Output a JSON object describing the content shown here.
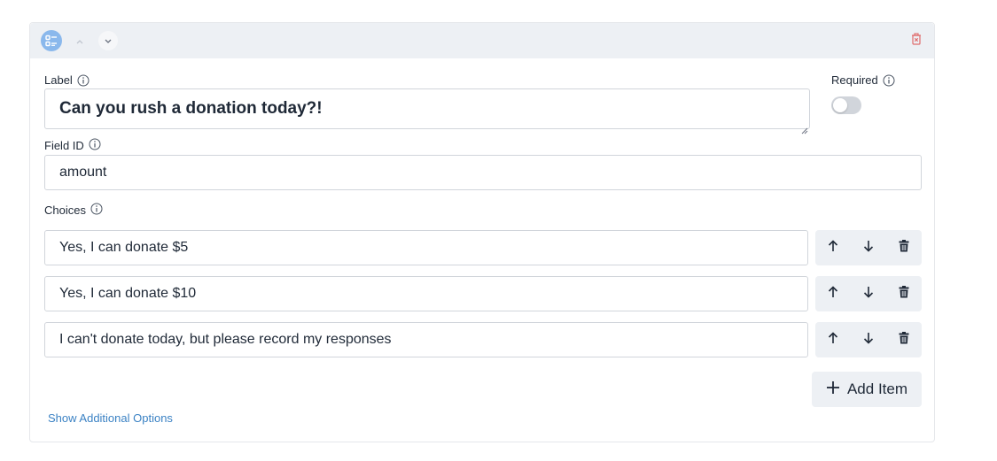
{
  "colors": {
    "accent": "#3b82c4",
    "header_bg": "#edf0f4",
    "type_icon_bg": "#8ab8ec",
    "delete_red": "#e06b6b"
  },
  "header": {
    "type_icon": "list-icon",
    "move_up_icon": "chevron-up-icon",
    "move_down_icon": "chevron-down-icon",
    "delete_icon": "trash-icon"
  },
  "label_field": {
    "label": "Label",
    "value": "Can you rush a donation today?!"
  },
  "required_field": {
    "label": "Required",
    "enabled": false
  },
  "field_id": {
    "label": "Field ID",
    "value": "amount"
  },
  "choices": {
    "label": "Choices",
    "items": [
      {
        "value": "Yes, I can donate $5"
      },
      {
        "value": "Yes, I can donate $10"
      },
      {
        "value": "I can't donate today, but please record my responses"
      }
    ]
  },
  "add_item": {
    "label": "Add Item"
  },
  "show_additional": {
    "label": "Show Additional Options"
  }
}
